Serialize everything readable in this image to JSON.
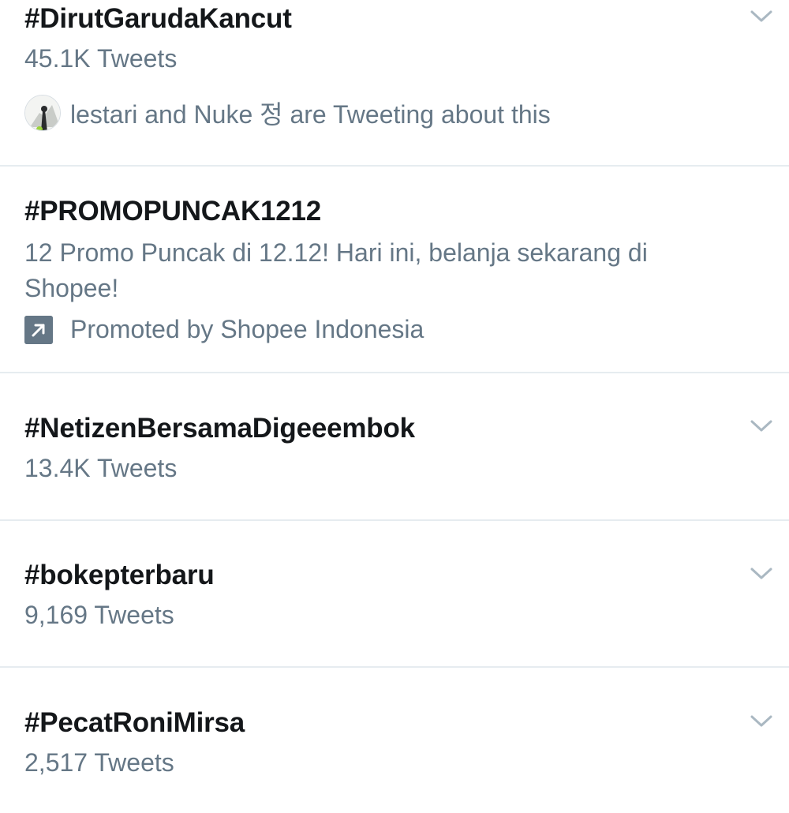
{
  "trends": [
    {
      "hashtag": "#DirutGarudaKancut",
      "count": "45.1K Tweets",
      "social_context": "lestari and Nuke 정 are Tweeting about this"
    },
    {
      "hashtag": "#PROMOPUNCAK1212",
      "description": "12 Promo Puncak di 12.12! Hari ini, belanja sekarang di Shopee!",
      "promoted_by": "Promoted by Shopee Indonesia"
    },
    {
      "hashtag": "#NetizenBersamaDigeeembok",
      "count": "13.4K Tweets"
    },
    {
      "hashtag": "#bokepterbaru",
      "count": "9,169 Tweets"
    },
    {
      "hashtag": "#PecatRoniMirsa",
      "count": "2,517 Tweets"
    }
  ],
  "icons": {
    "chevron": "chevron-down-icon",
    "promoted": "promoted-arrow-icon",
    "avatar": "avatar"
  },
  "colors": {
    "primary_text": "#14171a",
    "secondary_text": "#657786",
    "divider": "#e6ecf0",
    "chevron": "#aab8c2"
  }
}
